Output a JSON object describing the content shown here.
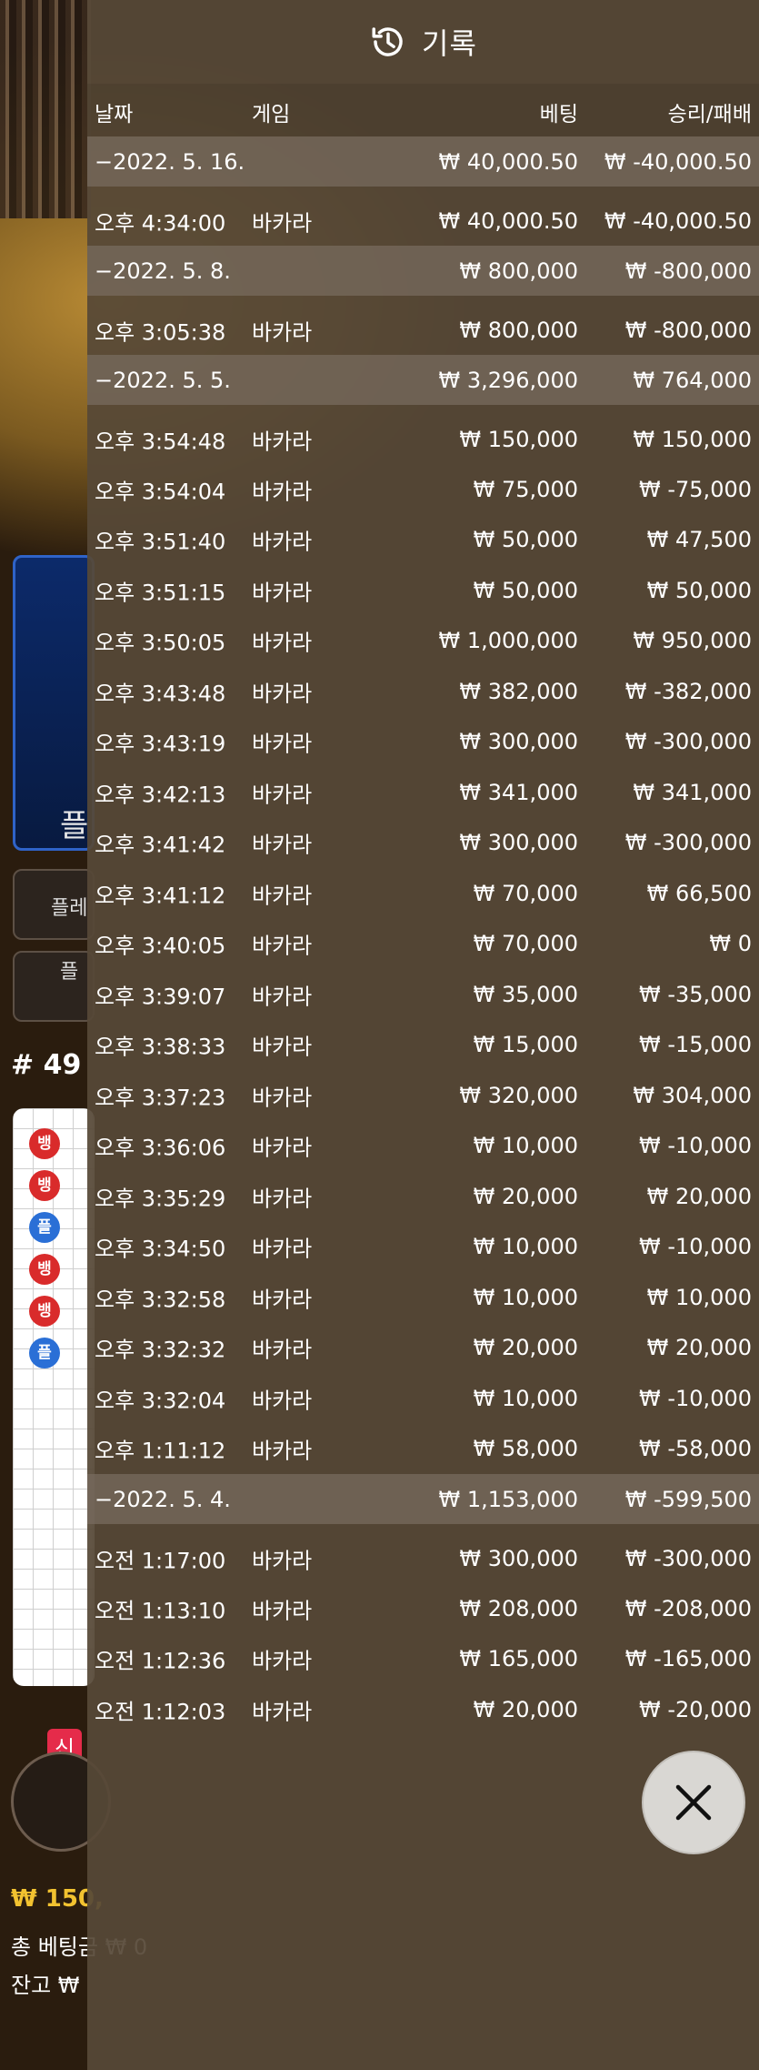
{
  "header": {
    "title": "기록",
    "icon": "history-icon"
  },
  "columns": {
    "date": "날짜",
    "game": "게임",
    "bet": "베팅",
    "result": "승리/패배"
  },
  "groups": [
    {
      "date": "−2022. 5. 16.",
      "bet_total": "₩ 40,000.50",
      "result_total": "₩ -40,000.50",
      "rows": [
        {
          "time": "오후 4:34:00",
          "game": "바카라",
          "bet": "₩ 40,000.50",
          "result": "₩ -40,000.50"
        }
      ]
    },
    {
      "date": "−2022. 5. 8.",
      "bet_total": "₩ 800,000",
      "result_total": "₩ -800,000",
      "rows": [
        {
          "time": "오후 3:05:38",
          "game": "바카라",
          "bet": "₩ 800,000",
          "result": "₩ -800,000"
        }
      ]
    },
    {
      "date": "−2022. 5. 5.",
      "bet_total": "₩ 3,296,000",
      "result_total": "₩ 764,000",
      "rows": [
        {
          "time": "오후 3:54:48",
          "game": "바카라",
          "bet": "₩ 150,000",
          "result": "₩ 150,000"
        },
        {
          "time": "오후 3:54:04",
          "game": "바카라",
          "bet": "₩ 75,000",
          "result": "₩ -75,000"
        },
        {
          "time": "오후 3:51:40",
          "game": "바카라",
          "bet": "₩ 50,000",
          "result": "₩ 47,500"
        },
        {
          "time": "오후 3:51:15",
          "game": "바카라",
          "bet": "₩ 50,000",
          "result": "₩ 50,000"
        },
        {
          "time": "오후 3:50:05",
          "game": "바카라",
          "bet": "₩ 1,000,000",
          "result": "₩ 950,000"
        },
        {
          "time": "오후 3:43:48",
          "game": "바카라",
          "bet": "₩ 382,000",
          "result": "₩ -382,000"
        },
        {
          "time": "오후 3:43:19",
          "game": "바카라",
          "bet": "₩ 300,000",
          "result": "₩ -300,000"
        },
        {
          "time": "오후 3:42:13",
          "game": "바카라",
          "bet": "₩ 341,000",
          "result": "₩ 341,000"
        },
        {
          "time": "오후 3:41:42",
          "game": "바카라",
          "bet": "₩ 300,000",
          "result": "₩ -300,000"
        },
        {
          "time": "오후 3:41:12",
          "game": "바카라",
          "bet": "₩ 70,000",
          "result": "₩ 66,500"
        },
        {
          "time": "오후 3:40:05",
          "game": "바카라",
          "bet": "₩ 70,000",
          "result": "₩ 0"
        },
        {
          "time": "오후 3:39:07",
          "game": "바카라",
          "bet": "₩ 35,000",
          "result": "₩ -35,000"
        },
        {
          "time": "오후 3:38:33",
          "game": "바카라",
          "bet": "₩ 15,000",
          "result": "₩ -15,000"
        },
        {
          "time": "오후 3:37:23",
          "game": "바카라",
          "bet": "₩ 320,000",
          "result": "₩ 304,000"
        },
        {
          "time": "오후 3:36:06",
          "game": "바카라",
          "bet": "₩ 10,000",
          "result": "₩ -10,000"
        },
        {
          "time": "오후 3:35:29",
          "game": "바카라",
          "bet": "₩ 20,000",
          "result": "₩ 20,000"
        },
        {
          "time": "오후 3:34:50",
          "game": "바카라",
          "bet": "₩ 10,000",
          "result": "₩ -10,000"
        },
        {
          "time": "오후 3:32:58",
          "game": "바카라",
          "bet": "₩ 10,000",
          "result": "₩ 10,000"
        },
        {
          "time": "오후 3:32:32",
          "game": "바카라",
          "bet": "₩ 20,000",
          "result": "₩ 20,000"
        },
        {
          "time": "오후 3:32:04",
          "game": "바카라",
          "bet": "₩ 10,000",
          "result": "₩ -10,000"
        },
        {
          "time": "오후 1:11:12",
          "game": "바카라",
          "bet": "₩ 58,000",
          "result": "₩ -58,000"
        }
      ]
    },
    {
      "date": "−2022. 5. 4.",
      "bet_total": "₩ 1,153,000",
      "result_total": "₩ -599,500",
      "rows": [
        {
          "time": "오전 1:17:00",
          "game": "바카라",
          "bet": "₩ 300,000",
          "result": "₩ -300,000"
        },
        {
          "time": "오전 1:13:10",
          "game": "바카라",
          "bet": "₩ 208,000",
          "result": "₩ -208,000"
        },
        {
          "time": "오전 1:12:36",
          "game": "바카라",
          "bet": "₩ 165,000",
          "result": "₩ -165,000"
        },
        {
          "time": "오전 1:12:03",
          "game": "바카라",
          "bet": "₩ 20,000",
          "result": "₩ -20,000"
        }
      ]
    }
  ],
  "background": {
    "player_label": "플",
    "button1_label": "플레",
    "button2_label": "플",
    "round": "# 49",
    "bead_labels": [
      "뱅",
      "뱅",
      "플",
      "뱅",
      "뱅",
      "플"
    ],
    "new_tag": "신",
    "balance": "₩ 150,",
    "total_bet": "총 베팅금 ₩ 0",
    "remaining": "잔고 ₩"
  },
  "close_button": {
    "icon": "close-icon"
  }
}
